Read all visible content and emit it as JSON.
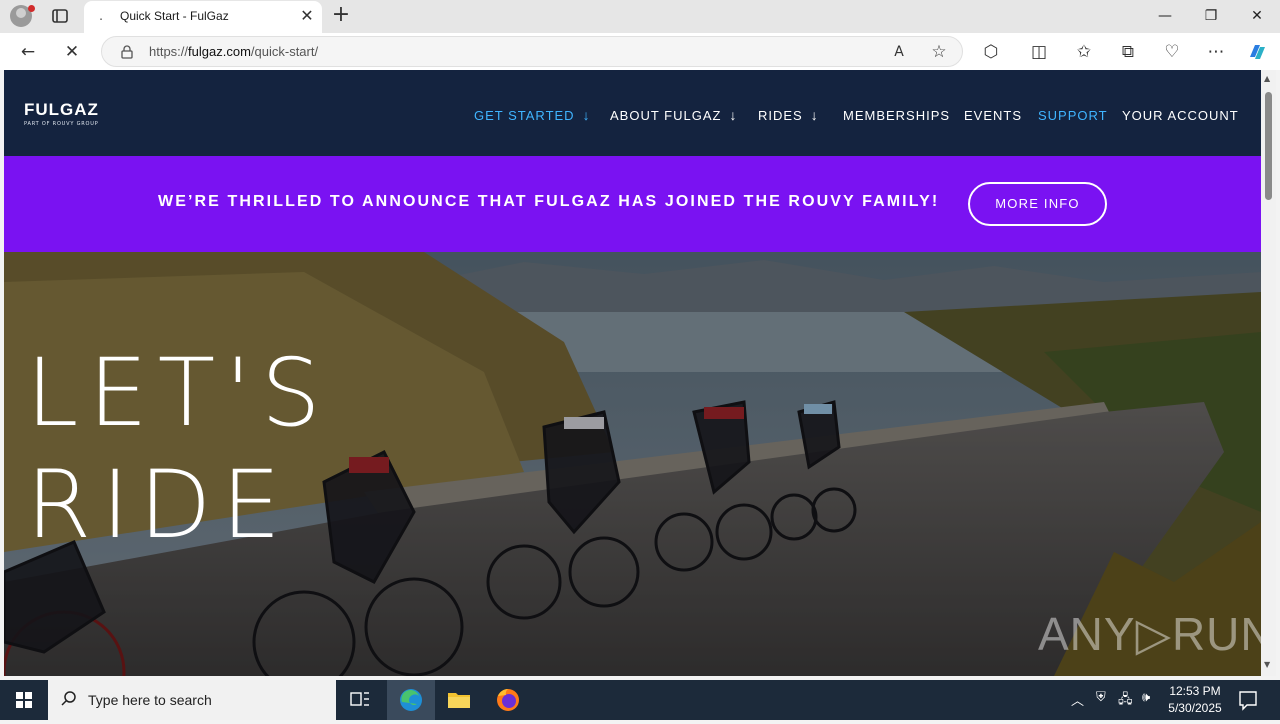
{
  "browser": {
    "tab_title": "Quick Start - FulGaz",
    "tab_favicon": ".",
    "url_prefix": "https://",
    "url_domain": "fulgaz.com",
    "url_path": "/quick-start/"
  },
  "site": {
    "logo_main": "FULGAZ",
    "logo_sub": "PART OF ROUVY GROUP",
    "nav": [
      {
        "label": "GET STARTED",
        "arrow": "↓"
      },
      {
        "label": "ABOUT FULGAZ",
        "arrow": "↓"
      },
      {
        "label": "RIDES",
        "arrow": "↓"
      },
      {
        "label": "MEMBERSHIPS"
      },
      {
        "label": "EVENTS"
      },
      {
        "label": "SUPPORT"
      },
      {
        "label": "YOUR ACCOUNT"
      }
    ],
    "banner_text": "WE’RE THRILLED TO ANNOUNCE THAT FULGAZ HAS JOINED THE ROUVY FAMILY!",
    "banner_button": "MORE INFO",
    "hero_line1": "LET'S",
    "hero_line2": "RIDE",
    "watermark": "ANY▷RUN",
    "colors": {
      "header": "#14233f",
      "banner": "#7a12f2",
      "nav_active": "#3fb4ff"
    }
  },
  "taskbar": {
    "search_placeholder": "Type here to search",
    "time": "12:53 PM",
    "date": "5/30/2025"
  }
}
